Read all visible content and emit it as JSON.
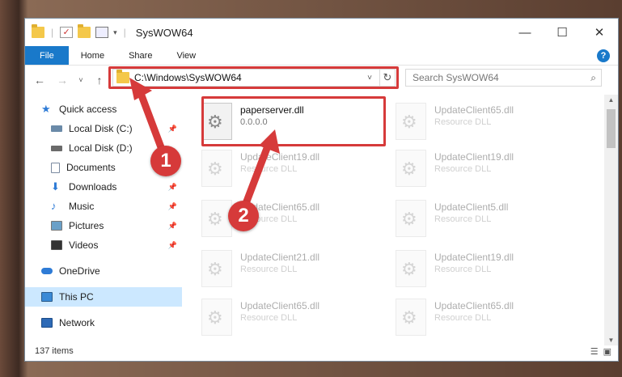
{
  "window": {
    "title": "SysWOW64",
    "controls": {
      "minimize": "—",
      "maximize": "☐",
      "close": "✕"
    }
  },
  "ribbon": {
    "tabs": [
      "File",
      "Home",
      "Share",
      "View"
    ],
    "help": "?"
  },
  "nav": {
    "back": "←",
    "forward": "→",
    "recent": "˅",
    "up": "↑",
    "address": "C:\\Windows\\SysWOW64",
    "address_dropdown": "˅",
    "refresh": "↻",
    "search_placeholder": "Search SysWOW64"
  },
  "sidebar": {
    "items": [
      {
        "label": "Quick access",
        "icon": "star-icon",
        "color": "#2e7bd6"
      },
      {
        "label": "Local Disk (C:)",
        "icon": "drive-icon",
        "color": "#6a8aa8"
      },
      {
        "label": "Local Disk (D:)",
        "icon": "drive-icon",
        "color": "#6a6a6a"
      },
      {
        "label": "Documents",
        "icon": "documents-icon",
        "color": "#7a8aa0"
      },
      {
        "label": "Downloads",
        "icon": "downloads-icon",
        "color": "#2e7bd6"
      },
      {
        "label": "Music",
        "icon": "music-icon",
        "color": "#2e7bd6"
      },
      {
        "label": "Pictures",
        "icon": "pictures-icon",
        "color": "#6aa0c8"
      },
      {
        "label": "Videos",
        "icon": "videos-icon",
        "color": "#333333"
      },
      {
        "label": "OneDrive",
        "icon": "cloud-icon",
        "color": "#2e7bd6"
      },
      {
        "label": "This PC",
        "icon": "computer-icon",
        "color": "#3a8ad6"
      },
      {
        "label": "Network",
        "icon": "network-icon",
        "color": "#2e6ab6"
      }
    ]
  },
  "files": [
    {
      "name": "paperserver.dll",
      "sub": "0.0.0.0"
    },
    {
      "name": "UpdateClient65.dll",
      "sub": "Resource DLL"
    },
    {
      "name": "UpdateClient19.dll",
      "sub": "Resource DLL"
    },
    {
      "name": "UpdateClient19.dll",
      "sub": "Resource DLL"
    },
    {
      "name": "UpdateClient65.dll",
      "sub": "Resource DLL"
    },
    {
      "name": "UpdateClient5.dll",
      "sub": "Resource DLL"
    },
    {
      "name": "UpdateClient21.dll",
      "sub": "Resource DLL"
    },
    {
      "name": "UpdateClient19.dll",
      "sub": "Resource DLL"
    },
    {
      "name": "UpdateClient65.dll",
      "sub": "Resource DLL"
    },
    {
      "name": "UpdateClient65.dll",
      "sub": "Resource DLL"
    }
  ],
  "status": {
    "count": "137 items"
  },
  "annotations": {
    "step1": "1",
    "step2": "2",
    "color": "#d63a3a"
  }
}
